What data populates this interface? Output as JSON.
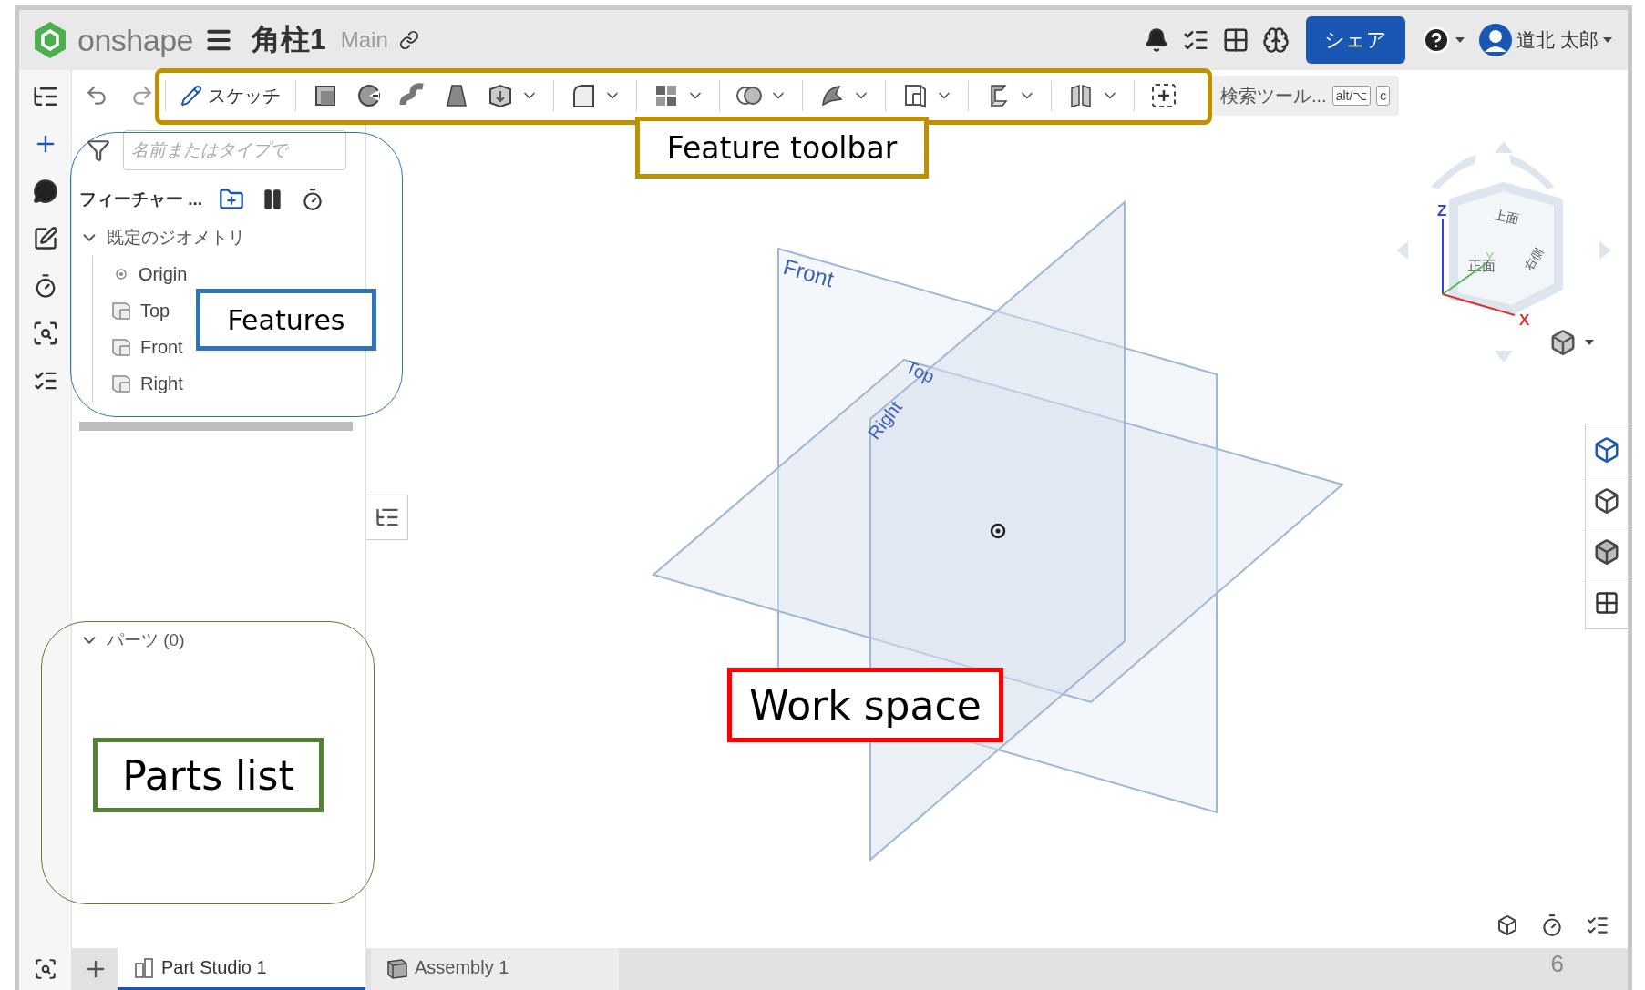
{
  "header": {
    "logo_text": "onshape",
    "document_title": "角柱1",
    "branch": "Main",
    "share_button": "シェア",
    "user_name": "道北 太郎"
  },
  "toolbar": {
    "sketch_label": "スケッチ",
    "tool_groups": [
      [
        {
          "kind": "extrude",
          "dropdown": false
        },
        {
          "kind": "revolve",
          "dropdown": false
        },
        {
          "kind": "sweep",
          "dropdown": false
        },
        {
          "kind": "loft",
          "dropdown": false
        },
        {
          "kind": "thicken",
          "dropdown": true
        }
      ],
      [
        {
          "kind": "fillet",
          "dropdown": true
        }
      ],
      [
        {
          "kind": "pattern",
          "dropdown": true
        }
      ],
      [
        {
          "kind": "boolean",
          "dropdown": true
        }
      ],
      [
        {
          "kind": "split",
          "dropdown": true
        }
      ],
      [
        {
          "kind": "plane",
          "dropdown": true
        }
      ],
      [
        {
          "kind": "sheet",
          "dropdown": true
        }
      ],
      [
        {
          "kind": "mirror",
          "dropdown": true
        }
      ],
      [
        {
          "kind": "insert",
          "dropdown": false
        }
      ]
    ],
    "search": {
      "label": "検索ツール...",
      "shortcut_keys": [
        "alt/⌥",
        "c"
      ]
    }
  },
  "feature_panel": {
    "filter_placeholder": "名前またはタイプで",
    "list_title": "フィーチャー ...",
    "tree": [
      {
        "label": "既定のジオメトリ",
        "expanded": true,
        "children": [
          {
            "label": "Origin",
            "kind": "origin"
          },
          {
            "label": "Top",
            "kind": "plane"
          },
          {
            "label": "Front",
            "kind": "plane"
          },
          {
            "label": "Right",
            "kind": "plane"
          }
        ]
      }
    ],
    "parts": {
      "label": "パーツ (0)",
      "expanded": true
    }
  },
  "viewport": {
    "plane_labels": [
      "Front",
      "Top",
      "Right"
    ],
    "view_cube": {
      "faces": [
        "上面",
        "正面",
        "右側"
      ],
      "axes": [
        "Z",
        "Y",
        "X"
      ]
    }
  },
  "tabs": [
    {
      "label": "Part Studio 1",
      "kind": "part_studio",
      "selected": true
    },
    {
      "label": "Assembly 1",
      "kind": "assembly",
      "selected": false
    }
  ],
  "page_number": "6",
  "annotations": [
    {
      "label": "Feature toolbar",
      "color": "#bf9000",
      "region_outline": true
    },
    {
      "label": "Features",
      "color": "#2e75b6",
      "region_outline": true
    },
    {
      "label": "Parts list",
      "color": "#538135",
      "region_outline": true
    },
    {
      "label": "Work space",
      "color": "#ff0000",
      "region_outline": false
    }
  ]
}
